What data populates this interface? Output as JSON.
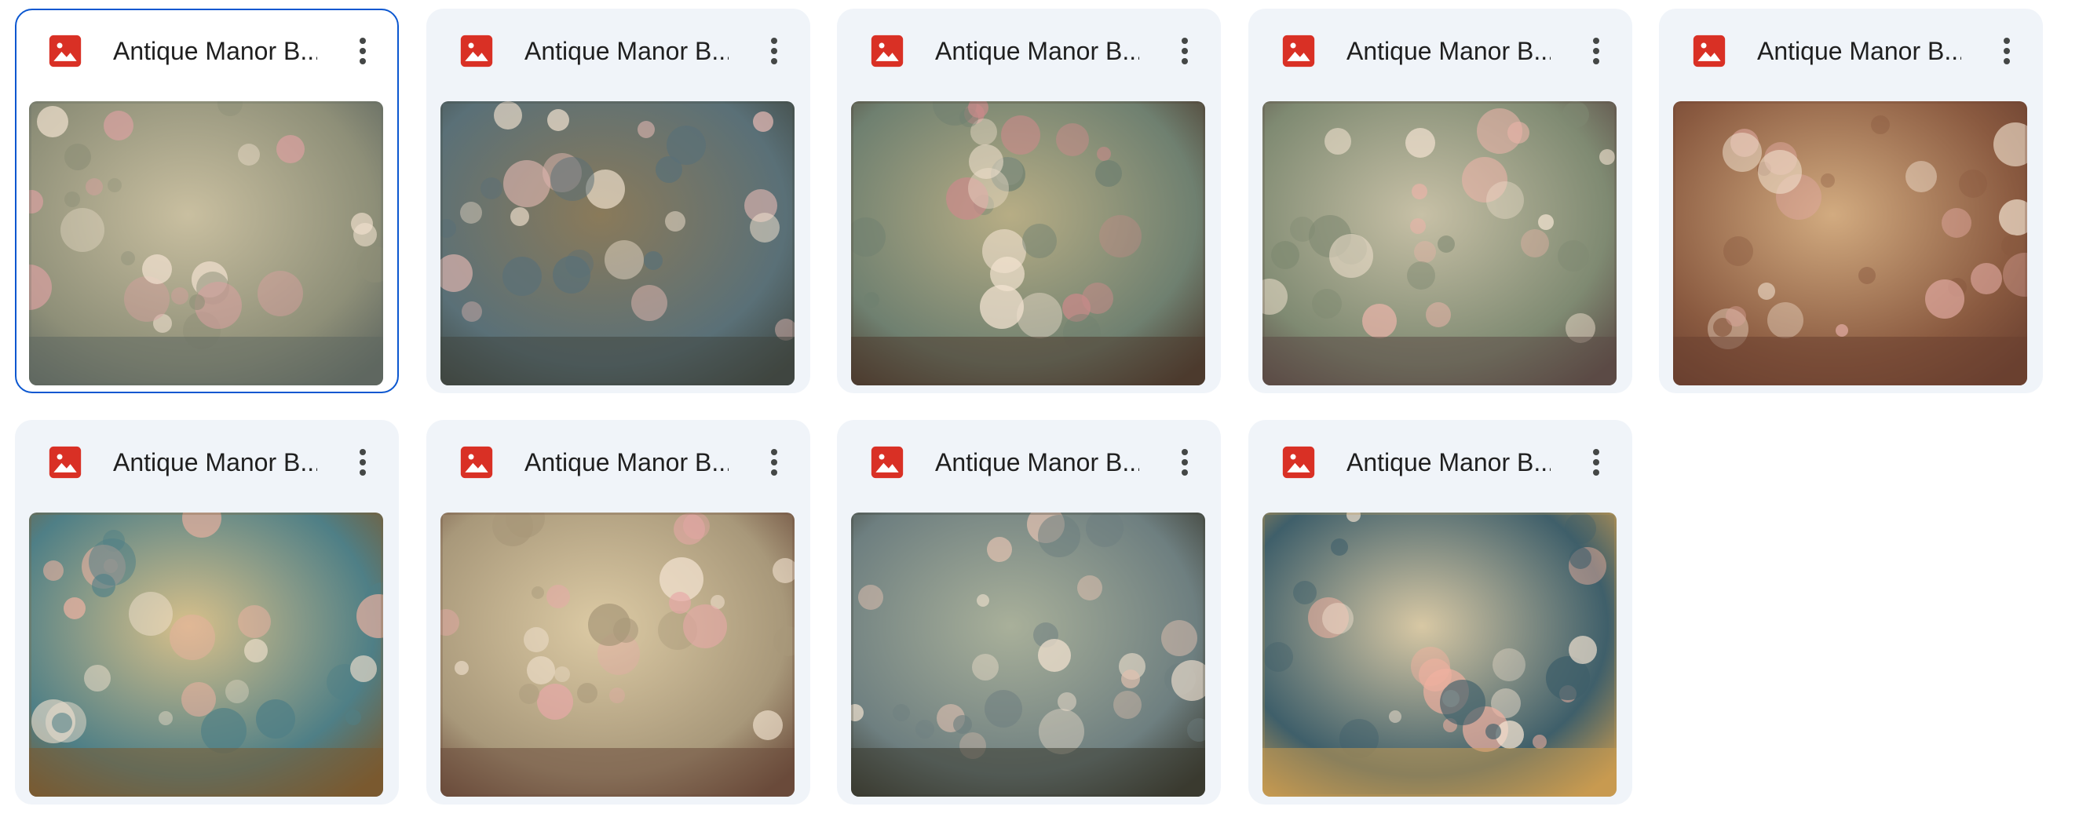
{
  "files": [
    {
      "title": "Antique Manor B...",
      "selected": true,
      "file_type": "image",
      "icon": "image-file-icon",
      "palette": [
        "#c9bfa0",
        "#8e8f78",
        "#d9a0a0",
        "#5f6760"
      ]
    },
    {
      "title": "Antique Manor B...",
      "selected": false,
      "file_type": "image",
      "icon": "image-file-icon",
      "palette": [
        "#8a7a5a",
        "#5a7077",
        "#e0b6b0",
        "#3f4640"
      ]
    },
    {
      "title": "Antique Manor B...",
      "selected": false,
      "file_type": "image",
      "icon": "image-file-icon",
      "palette": [
        "#b7ad85",
        "#6f8070",
        "#c98a8a",
        "#4c3b2e"
      ]
    },
    {
      "title": "Antique Manor B...",
      "selected": false,
      "file_type": "image",
      "icon": "image-file-icon",
      "palette": [
        "#c7c0a6",
        "#7f8a72",
        "#e8b3a8",
        "#5b4a45"
      ]
    },
    {
      "title": "Antique Manor B...",
      "selected": false,
      "file_type": "image",
      "icon": "image-file-icon",
      "palette": [
        "#d2ab80",
        "#8a5a40",
        "#e0a8a0",
        "#6a4030"
      ]
    },
    {
      "title": "Antique Manor B...",
      "selected": false,
      "file_type": "image",
      "icon": "image-file-icon",
      "palette": [
        "#d8c08a",
        "#4f7f86",
        "#e8b0a0",
        "#7a5a30"
      ]
    },
    {
      "title": "Antique Manor B...",
      "selected": false,
      "file_type": "image",
      "icon": "image-file-icon",
      "palette": [
        "#dccaa4",
        "#a8987a",
        "#e8a8a8",
        "#6a4a3a"
      ]
    },
    {
      "title": "Antique Manor B...",
      "selected": false,
      "file_type": "image",
      "icon": "image-file-icon",
      "palette": [
        "#a9b09a",
        "#6e7f80",
        "#e0c0b0",
        "#3a3a30"
      ]
    },
    {
      "title": "Antique Manor B...",
      "selected": false,
      "file_type": "image",
      "icon": "image-file-icon",
      "palette": [
        "#d8c8a4",
        "#3f5f6a",
        "#f0b0a0",
        "#c89a50"
      ]
    }
  ],
  "colors": {
    "card_bg": "#f0f4f9",
    "selected_border": "#0b57d0",
    "image_icon": "#d93025",
    "title_text": "#1f1f1f",
    "more_icon": "#444746"
  }
}
